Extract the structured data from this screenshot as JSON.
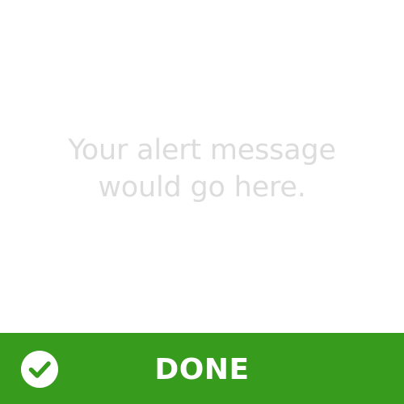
{
  "alert": {
    "message": "Your alert message would go here."
  },
  "done_button": {
    "label": "DONE",
    "icon": "checkmark-circle-icon"
  },
  "colors": {
    "background": "#ffffff",
    "message_text": "#dcdcdc",
    "button_background": "#379b1e",
    "button_text": "#ffffff"
  }
}
